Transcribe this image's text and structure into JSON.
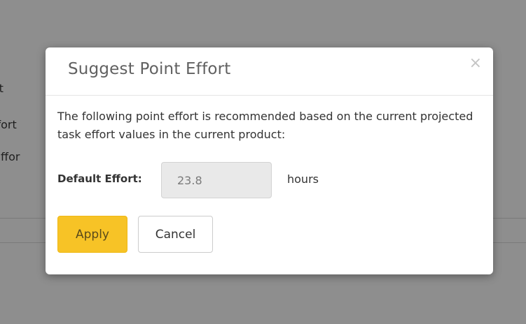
{
  "background": {
    "labels": [
      "rt",
      "Effort",
      "e Effor"
    ]
  },
  "modal": {
    "title": "Suggest Point Effort",
    "close_symbol": "×",
    "intro_text": "The following point effort is recommended based on the current projected task effort values in the current product:",
    "effort": {
      "label": "Default Effort:",
      "value": "23.8",
      "unit": "hours"
    },
    "buttons": {
      "apply_label": "Apply",
      "cancel_label": "Cancel"
    }
  },
  "colors": {
    "overlay": "#8e8e8e",
    "apply_button": "#f7c326",
    "input_background": "#e9e9e9"
  },
  "icons": {
    "close": "close-icon"
  }
}
